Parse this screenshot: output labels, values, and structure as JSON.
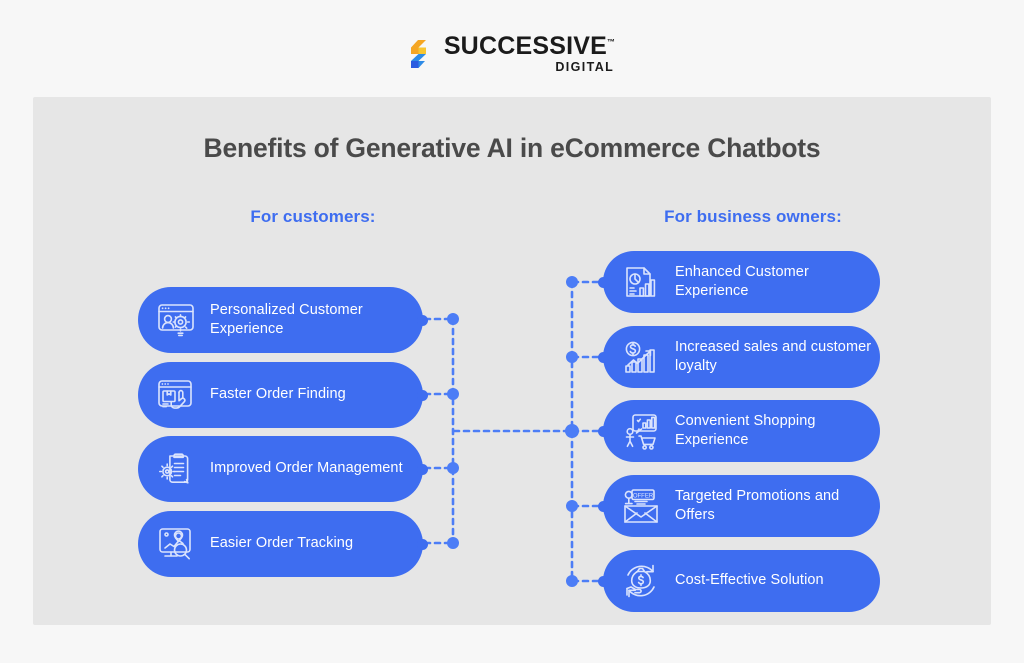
{
  "brand": {
    "name": "SUCCESSIVE",
    "trademark": "™",
    "tagline": "DIGITAL",
    "mark_icon": "successive-logo-icon",
    "colors": {
      "dark": "#1B1B1B",
      "orange": "#F5A623",
      "yellow": "#F8C630",
      "blue": "#2E8BE6",
      "deep_blue": "#2B5CE0"
    }
  },
  "card": {
    "title": "Benefits of Generative AI in eCommerce Chatbots",
    "background": "#E6E6E6",
    "title_color": "#4A4A4A",
    "accent": "#3E6DF0"
  },
  "columns": {
    "left": {
      "heading": "For customers:",
      "items": [
        {
          "label": "Personalized Customer Experience",
          "icon": "browser-user-idea-icon"
        },
        {
          "label": "Faster Order Finding",
          "icon": "browser-package-tap-icon"
        },
        {
          "label": "Improved Order Management",
          "icon": "clipboard-gear-icon"
        },
        {
          "label": "Easier Order Tracking",
          "icon": "map-route-search-icon"
        }
      ]
    },
    "right": {
      "heading": "For business owners:",
      "items": [
        {
          "label": "Enhanced Customer Experience",
          "icon": "report-piechart-barchart-icon"
        },
        {
          "label": "Increased sales and customer loyalty",
          "icon": "dollar-growth-chart-icon"
        },
        {
          "label": "Convenient Shopping Experience",
          "icon": "shopper-cart-chart-icon"
        },
        {
          "label": "Targeted Promotions and Offers",
          "icon": "envelope-offer-megaphone-icon"
        },
        {
          "label": "Cost-Effective Solution",
          "icon": "money-bag-hand-cycle-icon"
        }
      ]
    }
  }
}
